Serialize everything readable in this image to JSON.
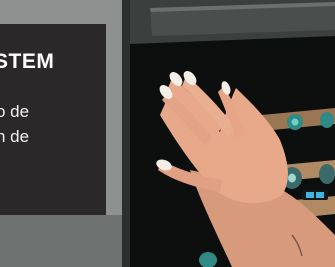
{
  "caption": {
    "heading": "STEM",
    "lines": [
      "!",
      "o de",
      "n de"
    ]
  },
  "colors": {
    "caption_background": "#2a2828",
    "caption_text": "#ffffff",
    "wall": "#8e918f",
    "fridge_door_frame": "#3b3f3e",
    "fridge_interior": "#0d0f0f",
    "shelf_wood": "#b08a62",
    "skin": "#e8a98a",
    "nail_polish": "#f4efe6"
  },
  "icons": [
    "hand-illustration",
    "wine-bottle-icon",
    "shelf-display-icon"
  ]
}
